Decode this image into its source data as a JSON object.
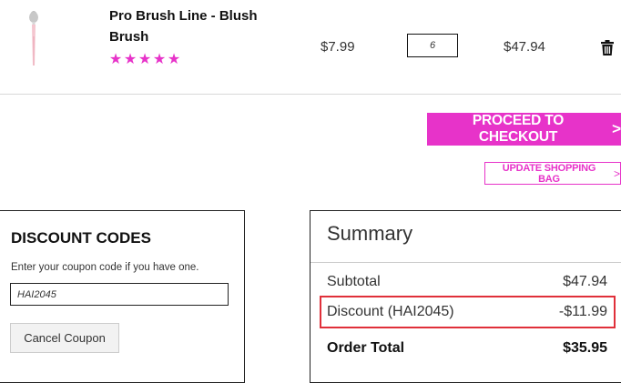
{
  "cart_item": {
    "name": "Pro Brush Line - Blush Brush",
    "rating_stars": 5,
    "price": "$7.99",
    "quantity": "6",
    "row_total": "$47.94",
    "star_color": "#e733c9"
  },
  "actions": {
    "checkout_label": "PROCEED TO CHECKOUT",
    "update_label": "UPDATE SHOPPING BAG",
    "accent_color": "#e733c9"
  },
  "discount": {
    "title": "DISCOUNT CODES",
    "help_text": "Enter your coupon code if you have one.",
    "coupon_value": "HAI2045",
    "cancel_label": "Cancel Coupon"
  },
  "summary": {
    "title": "Summary",
    "subtotal_label": "Subtotal",
    "subtotal_value": "$47.94",
    "discount_label": "Discount (HAI2045)",
    "discount_value": "-$11.99",
    "total_label": "Order Total",
    "total_value": "$35.95",
    "highlight_color": "#e0303a"
  },
  "icons": {
    "product": "makeup-brush-image",
    "delete": "trash-icon",
    "star": "star-icon",
    "chevron": "chevron-right-icon"
  }
}
